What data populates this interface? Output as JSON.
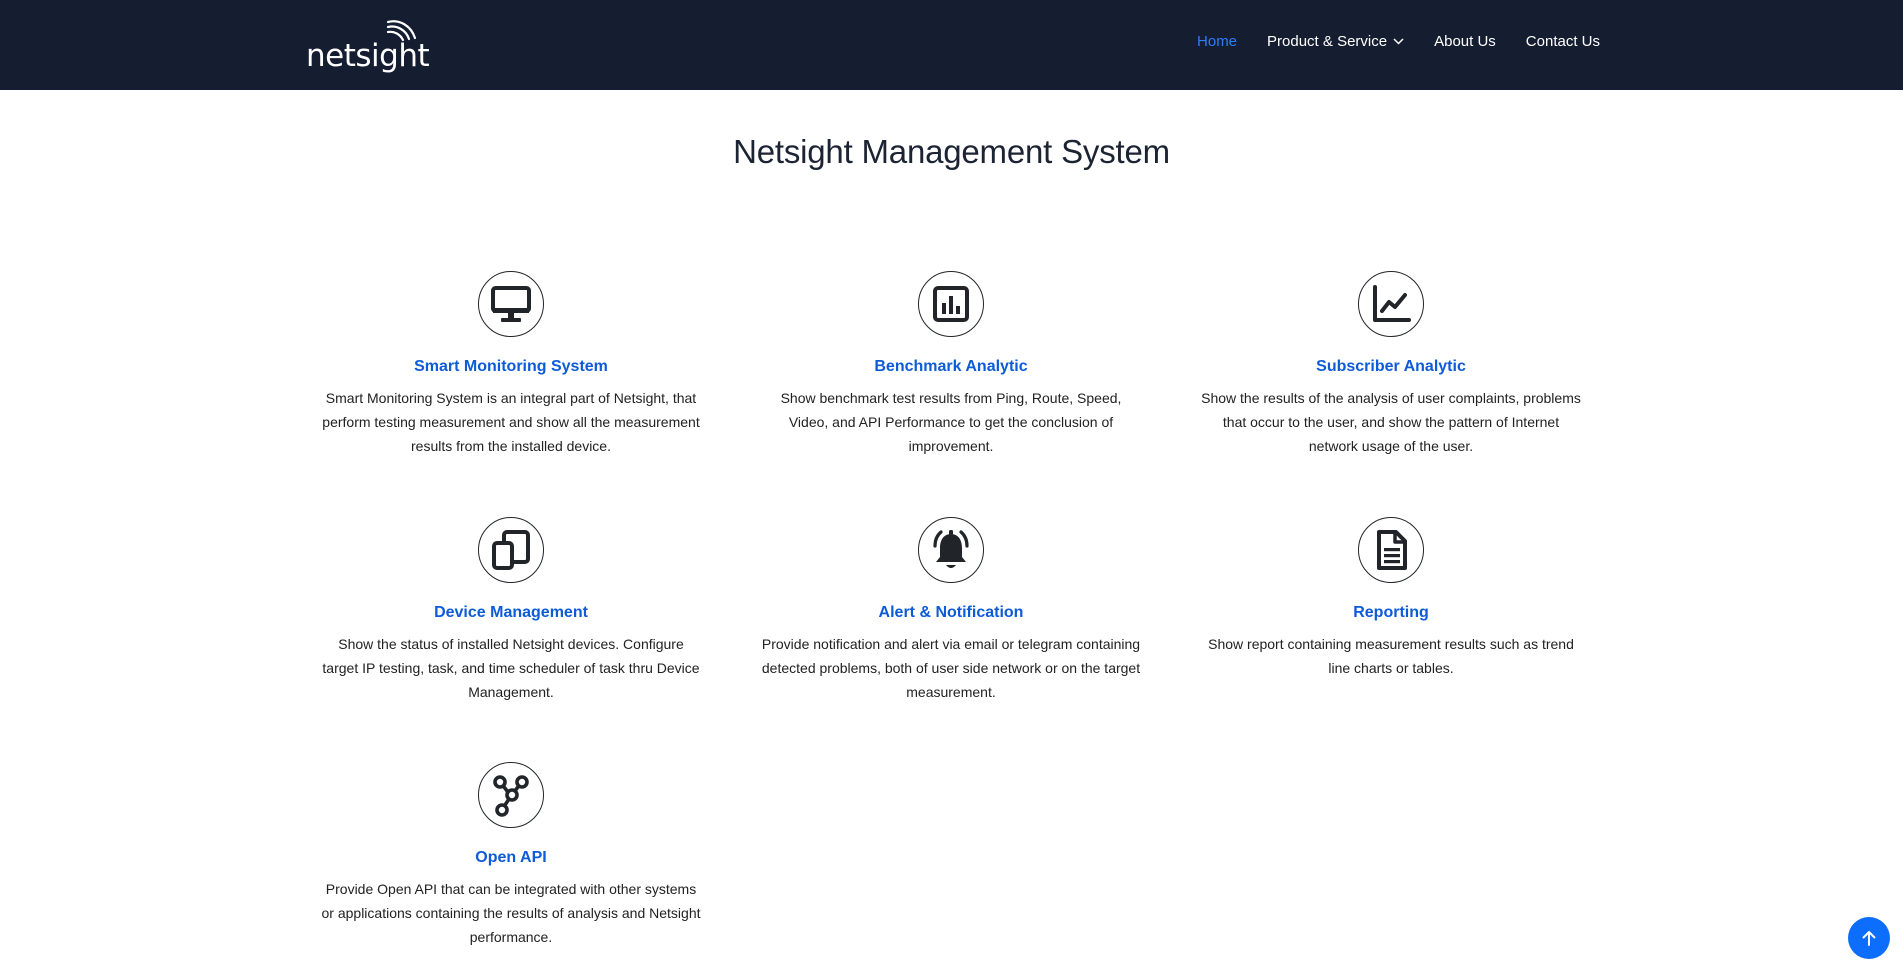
{
  "nav": {
    "logo_text": "netsight",
    "links": [
      "Home",
      "Product & Service",
      "About Us",
      "Contact Us"
    ]
  },
  "main": {
    "title": "Netsight Management System",
    "features": [
      {
        "icon": "monitor-icon",
        "title": "Smart Monitoring System",
        "desc": "Smart Monitoring System is an integral part of Netsight, that perform testing measurement and show all the measurement results from the installed device."
      },
      {
        "icon": "bar-chart-icon",
        "title": "Benchmark Analytic",
        "desc": "Show benchmark test results from Ping, Route, Speed, Video, and API Performance to get the conclusion of improvement."
      },
      {
        "icon": "line-chart-icon",
        "title": "Subscriber Analytic",
        "desc": "Show the results of the analysis of user complaints, problems that occur to the user, and show the pattern of Internet network usage of the user."
      },
      {
        "icon": "devices-icon",
        "title": "Device Management",
        "desc": "Show the status of installed Netsight devices. Configure target IP testing, task, and time scheduler of task thru Device Management."
      },
      {
        "icon": "bell-icon",
        "title": "Alert & Notification",
        "desc": "Provide notification and alert via email or telegram containing detected problems, both of user side network or on the target measurement."
      },
      {
        "icon": "document-icon",
        "title": "Reporting",
        "desc": "Show report containing measurement results such as trend line charts or tables."
      },
      {
        "icon": "nodes-icon",
        "title": "Open API",
        "desc": "Provide Open API that can be integrated with other systems or applications containing the results of analysis and Netsight performance."
      }
    ]
  },
  "colors": {
    "navbar": "#151d30",
    "accent": "#2f7cf6",
    "feature_title": "#0d5bd7",
    "back_to_top": "#0d6efd"
  }
}
